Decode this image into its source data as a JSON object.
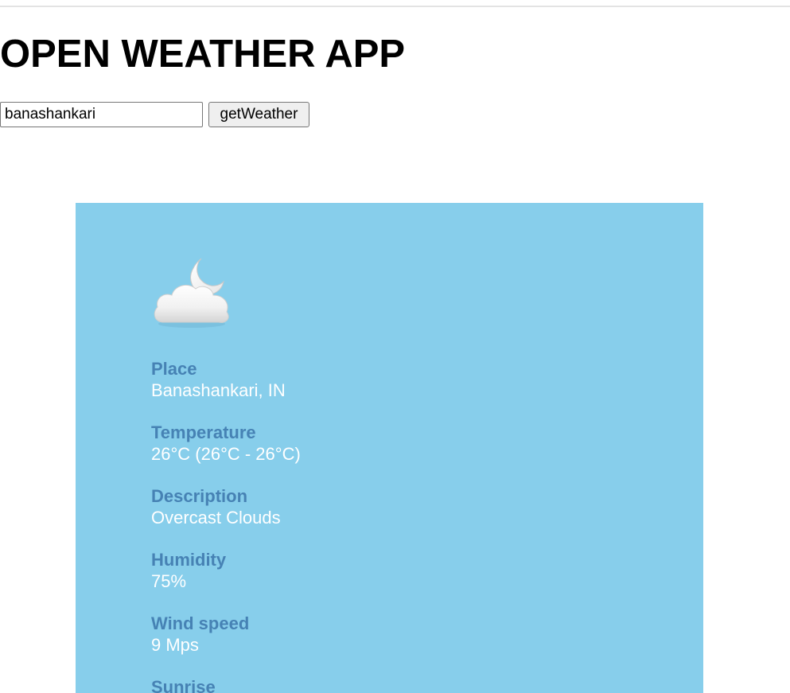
{
  "app": {
    "title": "OPEN WEATHER APP"
  },
  "search": {
    "value": "banashankari",
    "button_label": "getWeather"
  },
  "weather": {
    "icon": "cloud-moon-icon",
    "fields": [
      {
        "label": "Place",
        "value": "Banashankari, IN"
      },
      {
        "label": "Temperature",
        "value": "26°C (26°C - 26°C)"
      },
      {
        "label": "Description",
        "value": "Overcast Clouds"
      },
      {
        "label": "Humidity",
        "value": "75%"
      },
      {
        "label": "Wind speed",
        "value": "9 Mps"
      },
      {
        "label": "Sunrise",
        "value": ""
      }
    ]
  },
  "colors": {
    "card_background": "#87ceeb",
    "label": "#4682b4",
    "value": "#ffffff"
  }
}
